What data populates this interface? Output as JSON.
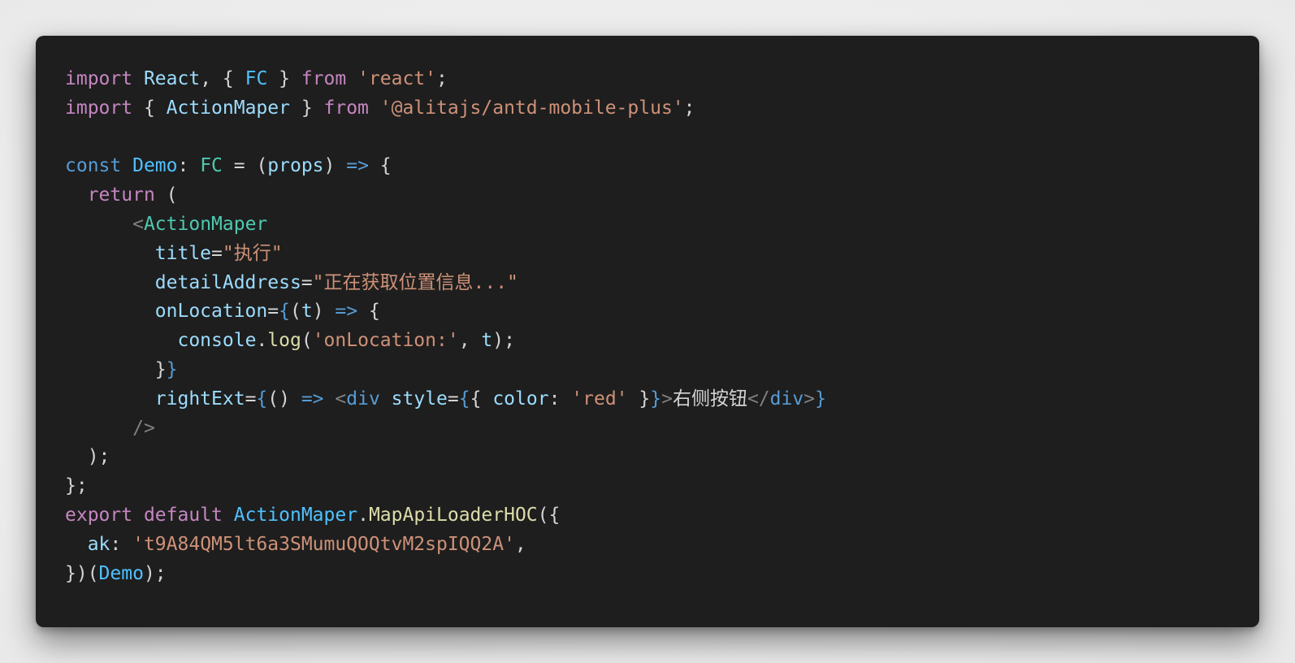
{
  "colors": {
    "keyword": "#c586c0",
    "storage": "#569cd6",
    "variable": "#9cdcfe",
    "const": "#4fc1ff",
    "type": "#4ec9b0",
    "string": "#ce9178",
    "function": "#dcdcaa",
    "tag": "#808080",
    "tagname": "#4ec9b0",
    "html": "#569cd6",
    "jsxbrace": "#569cd6",
    "punct": "#d4d4d4",
    "text": "#d4d4d4",
    "background": "#1e1e1e"
  },
  "code": {
    "language": "tsx",
    "lines": [
      [
        [
          "keyword",
          "import"
        ],
        [
          "punct",
          " "
        ],
        [
          "variable",
          "React"
        ],
        [
          "punct",
          ", { "
        ],
        [
          "const",
          "FC"
        ],
        [
          "punct",
          " } "
        ],
        [
          "keyword",
          "from"
        ],
        [
          "punct",
          " "
        ],
        [
          "string",
          "'react'"
        ],
        [
          "punct",
          ";"
        ]
      ],
      [
        [
          "keyword",
          "import"
        ],
        [
          "punct",
          " { "
        ],
        [
          "variable",
          "ActionMaper"
        ],
        [
          "punct",
          " } "
        ],
        [
          "keyword",
          "from"
        ],
        [
          "punct",
          " "
        ],
        [
          "string",
          "'@alitajs/antd-mobile-plus'"
        ],
        [
          "punct",
          ";"
        ]
      ],
      [],
      [
        [
          "storage",
          "const"
        ],
        [
          "punct",
          " "
        ],
        [
          "const",
          "Demo"
        ],
        [
          "punct",
          ": "
        ],
        [
          "type",
          "FC"
        ],
        [
          "punct",
          " = ("
        ],
        [
          "variable",
          "props"
        ],
        [
          "punct",
          ") "
        ],
        [
          "storage",
          "=>"
        ],
        [
          "punct",
          " {"
        ]
      ],
      [
        [
          "punct",
          "  "
        ],
        [
          "keyword",
          "return"
        ],
        [
          "punct",
          " ("
        ]
      ],
      [
        [
          "punct",
          "      "
        ],
        [
          "tag",
          "<"
        ],
        [
          "tagname",
          "ActionMaper"
        ]
      ],
      [
        [
          "punct",
          "        "
        ],
        [
          "variable",
          "title"
        ],
        [
          "punct",
          "="
        ],
        [
          "string",
          "\"执行\""
        ]
      ],
      [
        [
          "punct",
          "        "
        ],
        [
          "variable",
          "detailAddress"
        ],
        [
          "punct",
          "="
        ],
        [
          "string",
          "\"正在获取位置信息...\""
        ]
      ],
      [
        [
          "punct",
          "        "
        ],
        [
          "variable",
          "onLocation"
        ],
        [
          "punct",
          "="
        ],
        [
          "jsxbrace",
          "{"
        ],
        [
          "punct",
          "("
        ],
        [
          "variable",
          "t"
        ],
        [
          "punct",
          ") "
        ],
        [
          "storage",
          "=>"
        ],
        [
          "punct",
          " {"
        ]
      ],
      [
        [
          "punct",
          "          "
        ],
        [
          "variable",
          "console"
        ],
        [
          "punct",
          "."
        ],
        [
          "function",
          "log"
        ],
        [
          "punct",
          "("
        ],
        [
          "string",
          "'onLocation:'"
        ],
        [
          "punct",
          ", "
        ],
        [
          "variable",
          "t"
        ],
        [
          "punct",
          ");"
        ]
      ],
      [
        [
          "punct",
          "        }"
        ],
        [
          "jsxbrace",
          "}"
        ]
      ],
      [
        [
          "punct",
          "        "
        ],
        [
          "variable",
          "rightExt"
        ],
        [
          "punct",
          "="
        ],
        [
          "jsxbrace",
          "{"
        ],
        [
          "punct",
          "() "
        ],
        [
          "storage",
          "=>"
        ],
        [
          "punct",
          " "
        ],
        [
          "tag",
          "<"
        ],
        [
          "html",
          "div"
        ],
        [
          "punct",
          " "
        ],
        [
          "variable",
          "style"
        ],
        [
          "punct",
          "="
        ],
        [
          "jsxbrace",
          "{"
        ],
        [
          "punct",
          "{ "
        ],
        [
          "variable",
          "color"
        ],
        [
          "punct",
          ": "
        ],
        [
          "string",
          "'red'"
        ],
        [
          "punct",
          " }"
        ],
        [
          "jsxbrace",
          "}"
        ],
        [
          "tag",
          ">"
        ],
        [
          "text",
          "右侧按钮"
        ],
        [
          "tag",
          "</"
        ],
        [
          "html",
          "div"
        ],
        [
          "tag",
          ">"
        ],
        [
          "jsxbrace",
          "}"
        ]
      ],
      [
        [
          "punct",
          "      "
        ],
        [
          "tag",
          "/>"
        ]
      ],
      [
        [
          "punct",
          "  );"
        ]
      ],
      [
        [
          "punct",
          "};"
        ]
      ],
      [
        [
          "keyword",
          "export"
        ],
        [
          "punct",
          " "
        ],
        [
          "keyword",
          "default"
        ],
        [
          "punct",
          " "
        ],
        [
          "const",
          "ActionMaper"
        ],
        [
          "punct",
          "."
        ],
        [
          "function",
          "MapApiLoaderHOC"
        ],
        [
          "punct",
          "({"
        ]
      ],
      [
        [
          "punct",
          "  "
        ],
        [
          "variable",
          "ak"
        ],
        [
          "punct",
          ": "
        ],
        [
          "string",
          "'t9A84QM5lt6a3SMumuQOQtvM2spIQQ2A'"
        ],
        [
          "punct",
          ","
        ]
      ],
      [
        [
          "punct",
          "})("
        ],
        [
          "const",
          "Demo"
        ],
        [
          "punct",
          ");"
        ]
      ]
    ]
  }
}
